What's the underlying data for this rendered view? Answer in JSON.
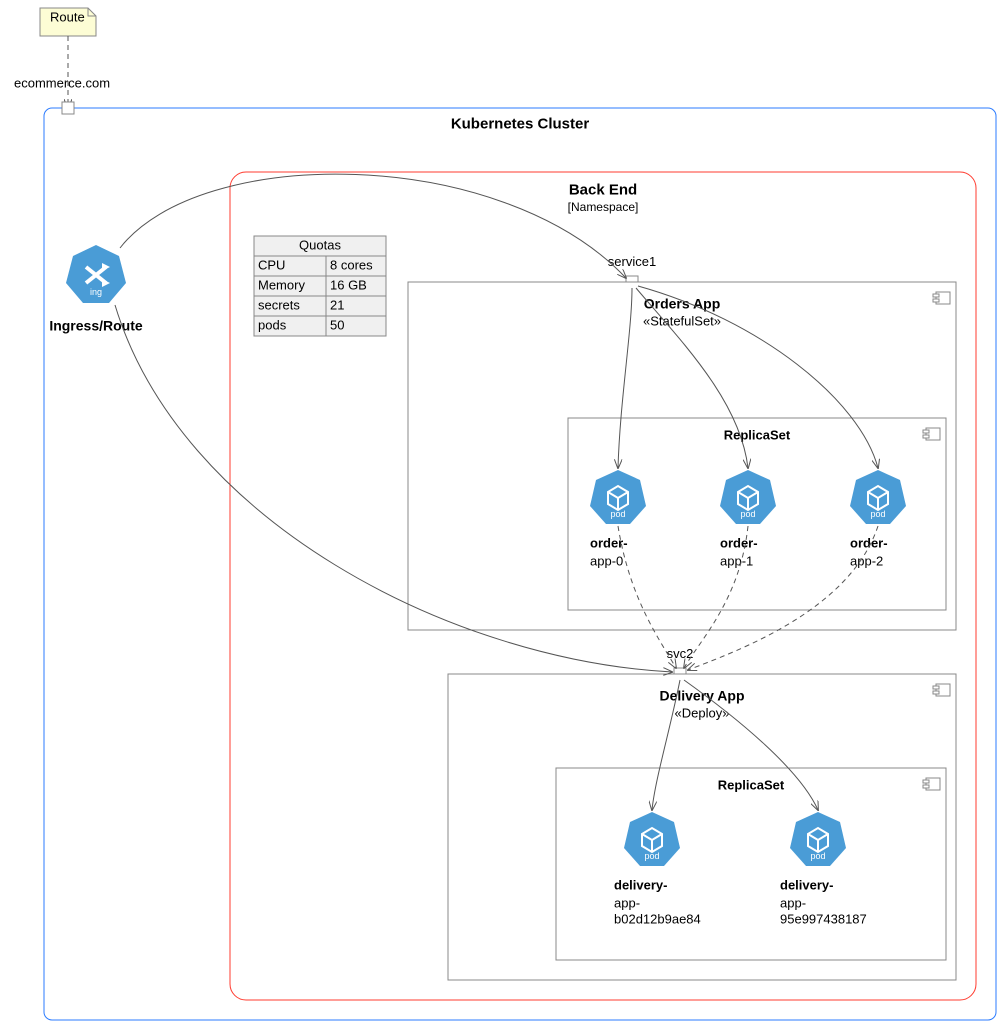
{
  "note": {
    "label": "Route"
  },
  "external": {
    "domain": "ecommerce.com"
  },
  "cluster": {
    "title": "Kubernetes Cluster"
  },
  "ingress": {
    "label": "Ingress/Route",
    "tag": "ing"
  },
  "namespace": {
    "title": "Back End",
    "subtitle": "[Namespace]",
    "quotas": {
      "header": "Quotas",
      "rows": [
        {
          "k": "CPU",
          "v": "8 cores"
        },
        {
          "k": "Memory",
          "v": "16 GB"
        },
        {
          "k": "secrets",
          "v": "21"
        },
        {
          "k": "pods",
          "v": "50"
        }
      ]
    },
    "service1": "service1",
    "ordersApp": {
      "title": "Orders App",
      "stereotype": "«StatefulSet»",
      "replicaSet": "ReplicaSet",
      "pods": [
        {
          "name1": "order-",
          "name2": "app-0"
        },
        {
          "name1": "order-",
          "name2": "app-1"
        },
        {
          "name1": "order-",
          "name2": "app-2"
        }
      ]
    },
    "service2": "svc2",
    "deliveryApp": {
      "title": "Delivery App",
      "stereotype": "«Deploy»",
      "replicaSet": "ReplicaSet",
      "pods": [
        {
          "name1": "delivery-",
          "name2": "app-",
          "name3": "b02d12b9ae84"
        },
        {
          "name1": "delivery-",
          "name2": "app-",
          "name3": "95e997438187"
        }
      ]
    }
  }
}
